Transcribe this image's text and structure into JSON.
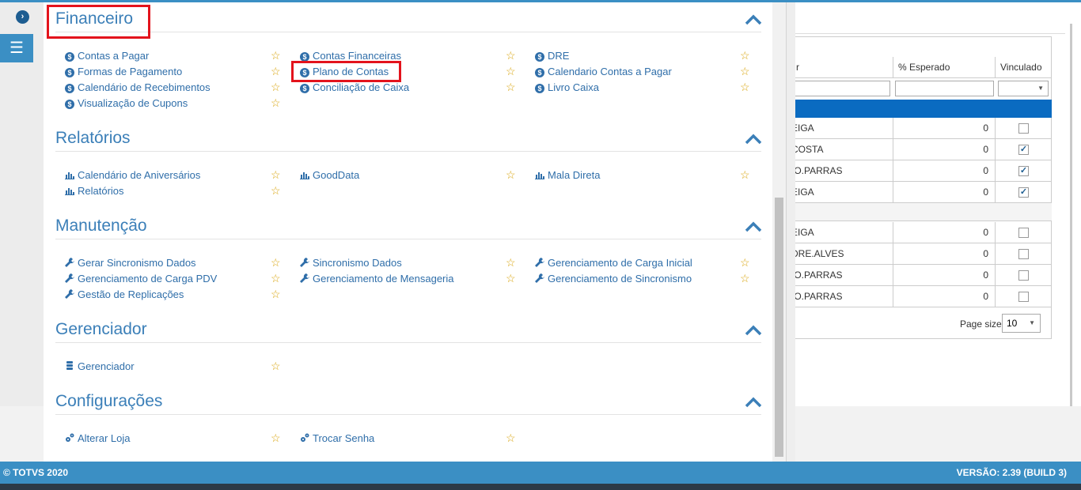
{
  "sections": [
    {
      "title": "Financeiro",
      "items": [
        {
          "label": "Contas a Pagar",
          "icon": "dollar-circle-icon"
        },
        {
          "label": "Formas de Pagamento",
          "icon": "dollar-circle-icon"
        },
        {
          "label": "Calendário de Recebimentos",
          "icon": "dollar-circle-icon"
        },
        {
          "label": "Visualização de Cupons",
          "icon": "dollar-circle-icon"
        },
        {
          "label": "Contas Financeiras",
          "icon": "dollar-circle-icon"
        },
        {
          "label": "Plano de Contas",
          "icon": "dollar-circle-icon"
        },
        {
          "label": "Conciliação de Caixa",
          "icon": "dollar-circle-icon"
        },
        {
          "label": "DRE",
          "icon": "dollar-circle-icon"
        },
        {
          "label": "Calendario Contas a Pagar",
          "icon": "dollar-circle-icon"
        },
        {
          "label": "Livro Caixa",
          "icon": "dollar-circle-icon"
        }
      ]
    },
    {
      "title": "Relatórios",
      "items": [
        {
          "label": "Calendário de Aniversários",
          "icon": "bar-chart-icon"
        },
        {
          "label": "Relatórios",
          "icon": "bar-chart-icon"
        },
        {
          "label": "GoodData",
          "icon": "bar-chart-icon"
        },
        {
          "label": "Mala Direta",
          "icon": "bar-chart-icon"
        }
      ]
    },
    {
      "title": "Manutenção",
      "items": [
        {
          "label": "Gerar Sincronismo Dados",
          "icon": "wrench-icon"
        },
        {
          "label": "Gerenciamento de Carga PDV",
          "icon": "wrench-icon"
        },
        {
          "label": "Gestão de Replicações",
          "icon": "wrench-icon"
        },
        {
          "label": "Sincronismo Dados",
          "icon": "wrench-icon"
        },
        {
          "label": "Gerenciamento de Mensageria",
          "icon": "wrench-icon"
        },
        {
          "label": "Gerenciamento de Carga Inicial",
          "icon": "wrench-icon"
        },
        {
          "label": "Gerenciamento de Sincronismo",
          "icon": "wrench-icon"
        }
      ]
    },
    {
      "title": "Gerenciador",
      "items": [
        {
          "label": "Gerenciador",
          "icon": "database-icon"
        }
      ]
    },
    {
      "title": "Configurações",
      "items": [
        {
          "label": "Alterar Loja",
          "icon": "gears-icon"
        },
        {
          "label": "Trocar Senha",
          "icon": "gears-icon"
        }
      ]
    }
  ],
  "background_table": {
    "headers": [
      "r",
      "% Esperado",
      "Vinculado"
    ],
    "rows": [
      {
        "name": "EIGA",
        "value": "0",
        "checked": false
      },
      {
        "name": "COSTA",
        "value": "0",
        "checked": true
      },
      {
        "name": "IO.PARRAS",
        "value": "0",
        "checked": true
      },
      {
        "name": "EIGA",
        "value": "0",
        "checked": true
      },
      {
        "name": "EIGA",
        "value": "0",
        "checked": false
      },
      {
        "name": "DRE.ALVES",
        "value": "0",
        "checked": false
      },
      {
        "name": "IO.PARRAS",
        "value": "0",
        "checked": false
      },
      {
        "name": "IO.PARRAS",
        "value": "0",
        "checked": false
      }
    ],
    "page_size_label": "Page size:",
    "page_size_value": "10"
  },
  "footer": {
    "copyright": "© TOTVS 2020",
    "version": "VERSÃO: 2.39 (BUILD 3)"
  },
  "colors": {
    "accent": "#3b8fc4",
    "link": "#2f6ea9",
    "star": "#d9a50f",
    "highlight": "#e3131c"
  }
}
